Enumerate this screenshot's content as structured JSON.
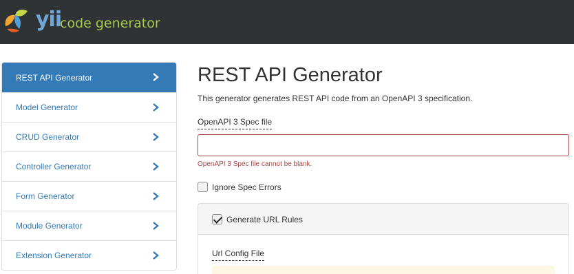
{
  "header": {
    "brand_mark": "yii",
    "brand_text": "code generator",
    "colors": {
      "bar": "#2f3336",
      "yii": "#6fa8d8",
      "text": "#a8c94a"
    }
  },
  "sidebar": {
    "items": [
      {
        "label": "REST API Generator",
        "active": true,
        "icon": "chevron-right-icon"
      },
      {
        "label": "Model Generator",
        "active": false,
        "icon": "chevron-right-icon"
      },
      {
        "label": "CRUD Generator",
        "active": false,
        "icon": "chevron-right-icon"
      },
      {
        "label": "Controller Generator",
        "active": false,
        "icon": "chevron-right-icon"
      },
      {
        "label": "Form Generator",
        "active": false,
        "icon": "chevron-right-icon"
      },
      {
        "label": "Module Generator",
        "active": false,
        "icon": "chevron-right-icon"
      },
      {
        "label": "Extension Generator",
        "active": false,
        "icon": "chevron-right-icon"
      }
    ],
    "colors": {
      "active_bg": "#337ab7",
      "link": "#337ab7"
    }
  },
  "main": {
    "title": "REST API Generator",
    "description": "This generator generates REST API code from an OpenAPI 3 specification.",
    "spec_file": {
      "label": "OpenAPI 3 Spec file",
      "value": "",
      "error": "OpenAPI 3 Spec file cannot be blank.",
      "error_color": "#a94442"
    },
    "ignore_errors": {
      "label": "Ignore Spec Errors",
      "checked": false
    },
    "url_rules": {
      "label": "Generate URL Rules",
      "checked": true,
      "config_label": "Url Config File"
    }
  }
}
